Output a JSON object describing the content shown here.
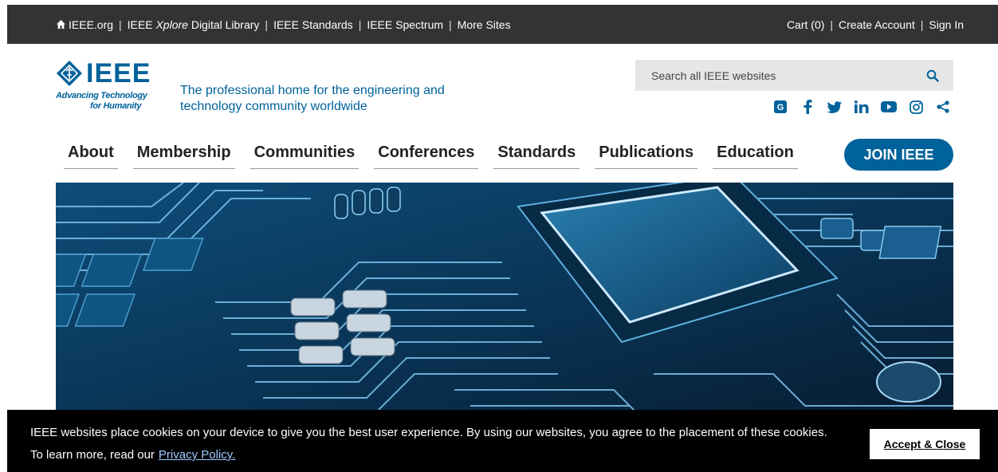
{
  "topbar": {
    "left_links": [
      {
        "label": "IEEE.org"
      },
      {
        "label_pre": "IEEE ",
        "label_em": "Xplore",
        "label_post": " Digital Library"
      },
      {
        "label": "IEEE Standards"
      },
      {
        "label": "IEEE Spectrum"
      },
      {
        "label": "More Sites"
      }
    ],
    "separator": "|",
    "right_links": [
      {
        "label": "Cart (0)"
      },
      {
        "label": "Create Account"
      },
      {
        "label": "Sign In"
      }
    ]
  },
  "logo": {
    "brand": "IEEE",
    "tagline_line1": "Advancing Technology",
    "tagline_line2": "for Humanity"
  },
  "headline": "The professional home for the engineering and technology community worldwide",
  "search": {
    "placeholder": "Search all IEEE websites"
  },
  "social": [
    {
      "icon": "ieee-collabratec-icon",
      "glyph": "G"
    },
    {
      "icon": "facebook-icon",
      "glyph": "f"
    },
    {
      "icon": "twitter-icon",
      "glyph": "t"
    },
    {
      "icon": "linkedin-icon",
      "glyph": "in"
    },
    {
      "icon": "youtube-icon",
      "glyph": "▶"
    },
    {
      "icon": "instagram-icon",
      "glyph": "◎"
    },
    {
      "icon": "share-icon",
      "glyph": "<"
    }
  ],
  "nav": {
    "items": [
      "About",
      "Membership",
      "Communities",
      "Conferences",
      "Standards",
      "Publications",
      "Education"
    ],
    "join_label": "JOIN IEEE"
  },
  "cookie": {
    "message": "IEEE websites place cookies on your device to give you the best user experience. By using our websites, you agree to the placement of these cookies. To learn more, read our",
    "link_label": "Privacy Policy.",
    "accept_label": "Accept & Close"
  },
  "colors": {
    "brand_blue": "#00629b",
    "topbar_bg": "#333333",
    "cookie_bg": "#000000"
  }
}
